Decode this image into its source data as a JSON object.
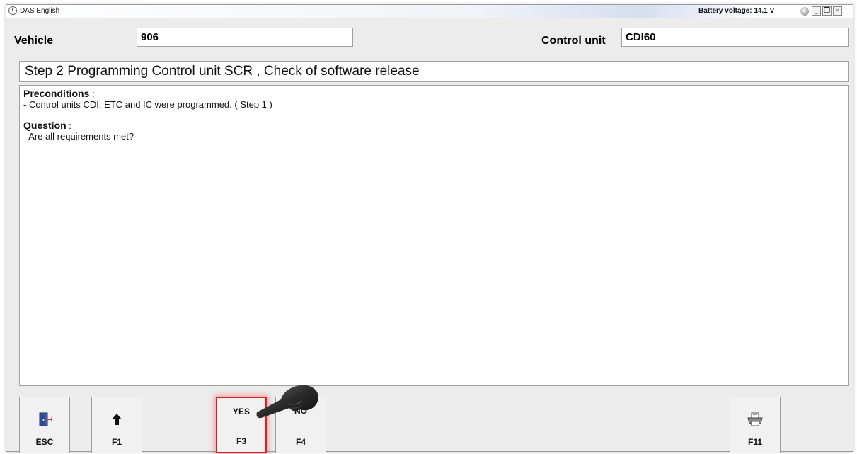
{
  "titlebar": {
    "app_title": "DAS English",
    "battery": "Battery voltage: 14.1 V",
    "minimize": "_",
    "restore": "❐",
    "close": "×"
  },
  "header": {
    "vehicle_label": "Vehicle",
    "vehicle_value": "906",
    "control_unit_label": "Control unit",
    "control_unit_value": "CDI60"
  },
  "step_title": "Step 2 Programming Control unit SCR , Check of software release",
  "content": {
    "preconditions_title": "Preconditions",
    "preconditions_colon": " :",
    "preconditions_text": "- Control units CDI, ETC and IC were programmed. ( Step 1 )",
    "question_title": "Question",
    "question_colon": " :",
    "question_text": "- Are all requirements met?"
  },
  "buttons": {
    "esc": {
      "key": "ESC",
      "icon": "exit-door-icon"
    },
    "f1": {
      "key": "F1",
      "icon": "arrow-up-icon"
    },
    "f3": {
      "top": "YES",
      "key": "F3"
    },
    "f4": {
      "top": "NO",
      "key": "F4"
    },
    "f11": {
      "key": "F11",
      "icon": "printer-icon"
    }
  },
  "colors": {
    "highlight": "#e02020",
    "window_bg": "#ececec"
  }
}
